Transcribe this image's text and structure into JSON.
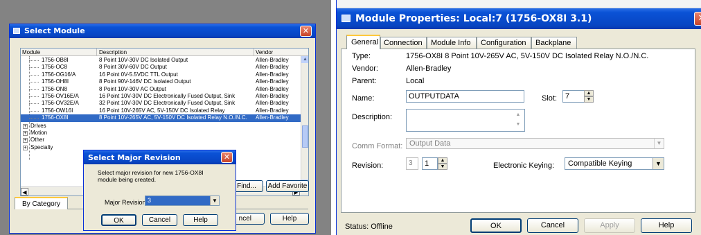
{
  "left": {
    "title": "Select Module",
    "columns": [
      "Module",
      "Description",
      "Vendor"
    ],
    "rows": [
      {
        "module": "1756-OB8I",
        "desc": "8 Point 10V-30V DC Isolated Output",
        "vendor": "Allen-Bradley"
      },
      {
        "module": "1756-OC8",
        "desc": "8 Point 30V-60V DC Output",
        "vendor": "Allen-Bradley"
      },
      {
        "module": "1756-OG16/A",
        "desc": "16 Point 0V-5.5VDC TTL Output",
        "vendor": "Allen-Bradley"
      },
      {
        "module": "1756-OH8I",
        "desc": "8 Point 90V-146V DC Isolated Output",
        "vendor": "Allen-Bradley"
      },
      {
        "module": "1756-ON8",
        "desc": "8 Point 10V-30V AC Output",
        "vendor": "Allen-Bradley"
      },
      {
        "module": "1756-OV16E/A",
        "desc": "16 Point 10V-30V DC Electronically Fused Output, Sink",
        "vendor": "Allen-Bradley"
      },
      {
        "module": "1756-OV32E/A",
        "desc": "32 Point 10V-30V DC Electronically Fused Output, Sink",
        "vendor": "Allen-Bradley"
      },
      {
        "module": "1756-OW16I",
        "desc": "16 Point 10V-265V AC, 5V-150V DC Isolated Relay",
        "vendor": "Allen-Bradley"
      },
      {
        "module": "1756-OX8I",
        "desc": "8 Point 10V-265V AC, 5V-150V DC Isolated Relay N.O./N.C.",
        "vendor": "Allen-Bradley"
      }
    ],
    "groups": [
      "Drives",
      "Motion",
      "Other",
      "Specialty"
    ],
    "find_label": "Find...",
    "add_favorite_label": "Add Favorite",
    "by_category_label": "By Category",
    "cancel_label": "ncel",
    "help_label": "Help"
  },
  "major": {
    "title": "Select Major Revision",
    "message": "Select major revision for new 1756-OX8I module being created.",
    "major_label": "Major Revision:",
    "major_value": "3",
    "ok_label": "OK",
    "cancel_label": "Cancel",
    "help_label": "Help"
  },
  "right": {
    "title": "Module Properties: Local:7 (1756-OX8I 3.1)",
    "tabs": [
      "General",
      "Connection",
      "Module Info",
      "Configuration",
      "Backplane"
    ],
    "type_label": "Type:",
    "type_value": "1756-OX8I 8 Point 10V-265V AC, 5V-150V DC Isolated Relay N.O./N.C.",
    "vendor_label": "Vendor:",
    "vendor_value": "Allen-Bradley",
    "parent_label": "Parent:",
    "parent_value": "Local",
    "name_label": "Name:",
    "name_value": "OUTPUTDATA",
    "slot_label": "Slot:",
    "slot_value": "7",
    "description_label": "Description:",
    "description_value": "",
    "comm_format_label": "Comm Format:",
    "comm_format_value": "Output Data",
    "revision_label": "Revision:",
    "revision_major": "3",
    "revision_minor": "1",
    "keying_label": "Electronic Keying:",
    "keying_value": "Compatible Keying",
    "status": "Status:  Offline",
    "ok_label": "OK",
    "cancel_label": "Cancel",
    "apply_label": "Apply",
    "help_label": "Help"
  },
  "colors": {
    "title_blue": "#0a52d6",
    "selection": "#316ac5",
    "dialog_bg": "#ece9d8",
    "backdrop": "#838383"
  }
}
